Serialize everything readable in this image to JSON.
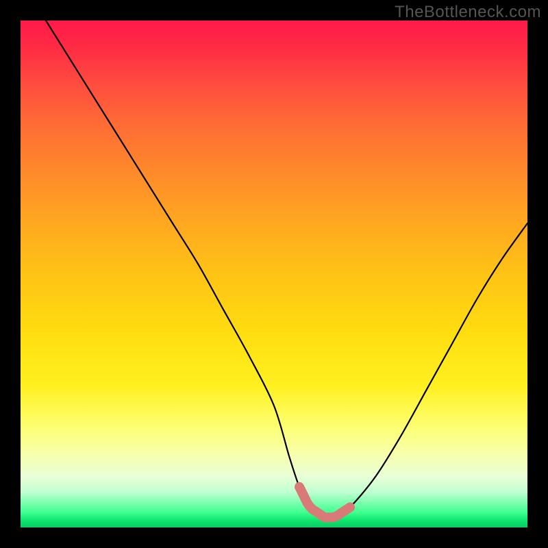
{
  "watermark": "TheBottleneck.com",
  "chart_data": {
    "type": "line",
    "title": "",
    "xlabel": "",
    "ylabel": "",
    "xlim": [
      0,
      100
    ],
    "ylim": [
      0,
      100
    ],
    "grid": false,
    "legend": false,
    "series": [
      {
        "name": "bottleneck-curve",
        "color": "#000000",
        "x": [
          5,
          10,
          15,
          20,
          25,
          30,
          35,
          40,
          45,
          50,
          53,
          55,
          57,
          60,
          62,
          65,
          70,
          75,
          80,
          85,
          90,
          95,
          100
        ],
        "values": [
          100,
          92,
          84,
          76,
          68,
          60,
          52,
          43,
          34,
          24,
          14,
          8,
          4,
          2,
          2,
          4,
          10,
          18,
          27,
          36,
          45,
          53,
          60
        ]
      }
    ],
    "highlight": {
      "name": "optimal-range",
      "color": "#d87a78",
      "x_start": 55,
      "x_end": 65,
      "floor_value": 2
    },
    "background_gradient": {
      "top_color": "#ff1a4a",
      "bottom_color": "#08cc60",
      "description": "vertical red-to-green gradient indicating bottleneck severity"
    }
  }
}
